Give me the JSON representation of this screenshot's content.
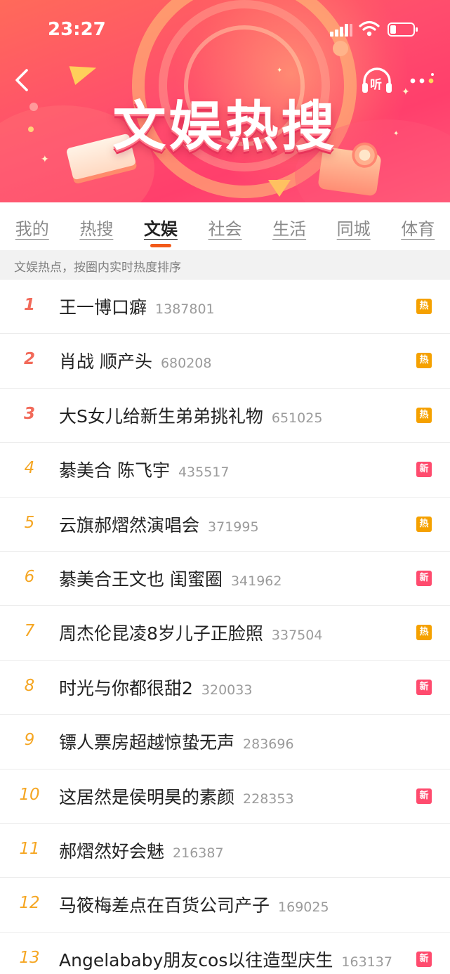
{
  "status_bar": {
    "time": "23:27"
  },
  "banner": {
    "title": "文娱热搜",
    "listen_icon_text": "听"
  },
  "tabs": [
    {
      "label": "我的",
      "active": false
    },
    {
      "label": "热搜",
      "active": false
    },
    {
      "label": "文娱",
      "active": true
    },
    {
      "label": "社会",
      "active": false
    },
    {
      "label": "生活",
      "active": false
    },
    {
      "label": "同城",
      "active": false
    },
    {
      "label": "体育",
      "active": false
    }
  ],
  "subheader": "文娱热点，按圈内实时热度排序",
  "badge_colors": {
    "热": "#f5a100",
    "新": "#ff4b6e"
  },
  "items": [
    {
      "rank": "1",
      "title": "王一博口癖",
      "count": "1387801",
      "badge": "热"
    },
    {
      "rank": "2",
      "title": "肖战 顺产头",
      "count": "680208",
      "badge": "热"
    },
    {
      "rank": "3",
      "title": "大S女儿给新生弟弟挑礼物",
      "count": "651025",
      "badge": "热"
    },
    {
      "rank": "4",
      "title": "綦美合 陈飞宇",
      "count": "435517",
      "badge": "新"
    },
    {
      "rank": "5",
      "title": "云旗郝熠然演唱会",
      "count": "371995",
      "badge": "热"
    },
    {
      "rank": "6",
      "title": "綦美合王文也 闺蜜圈",
      "count": "341962",
      "badge": "新"
    },
    {
      "rank": "7",
      "title": "周杰伦昆凌8岁儿子正脸照",
      "count": "337504",
      "badge": "热"
    },
    {
      "rank": "8",
      "title": "时光与你都很甜2",
      "count": "320033",
      "badge": "新"
    },
    {
      "rank": "9",
      "title": "镖人票房超越惊蛰无声",
      "count": "283696",
      "badge": ""
    },
    {
      "rank": "10",
      "title": "这居然是侯明昊的素颜",
      "count": "228353",
      "badge": "新"
    },
    {
      "rank": "11",
      "title": "郝熠然好会魅",
      "count": "216387",
      "badge": ""
    },
    {
      "rank": "12",
      "title": "马筱梅差点在百货公司产子",
      "count": "169025",
      "badge": ""
    },
    {
      "rank": "13",
      "title": "Angelababy朋友cos以往造型庆生",
      "count": "163137",
      "badge": "新"
    }
  ]
}
